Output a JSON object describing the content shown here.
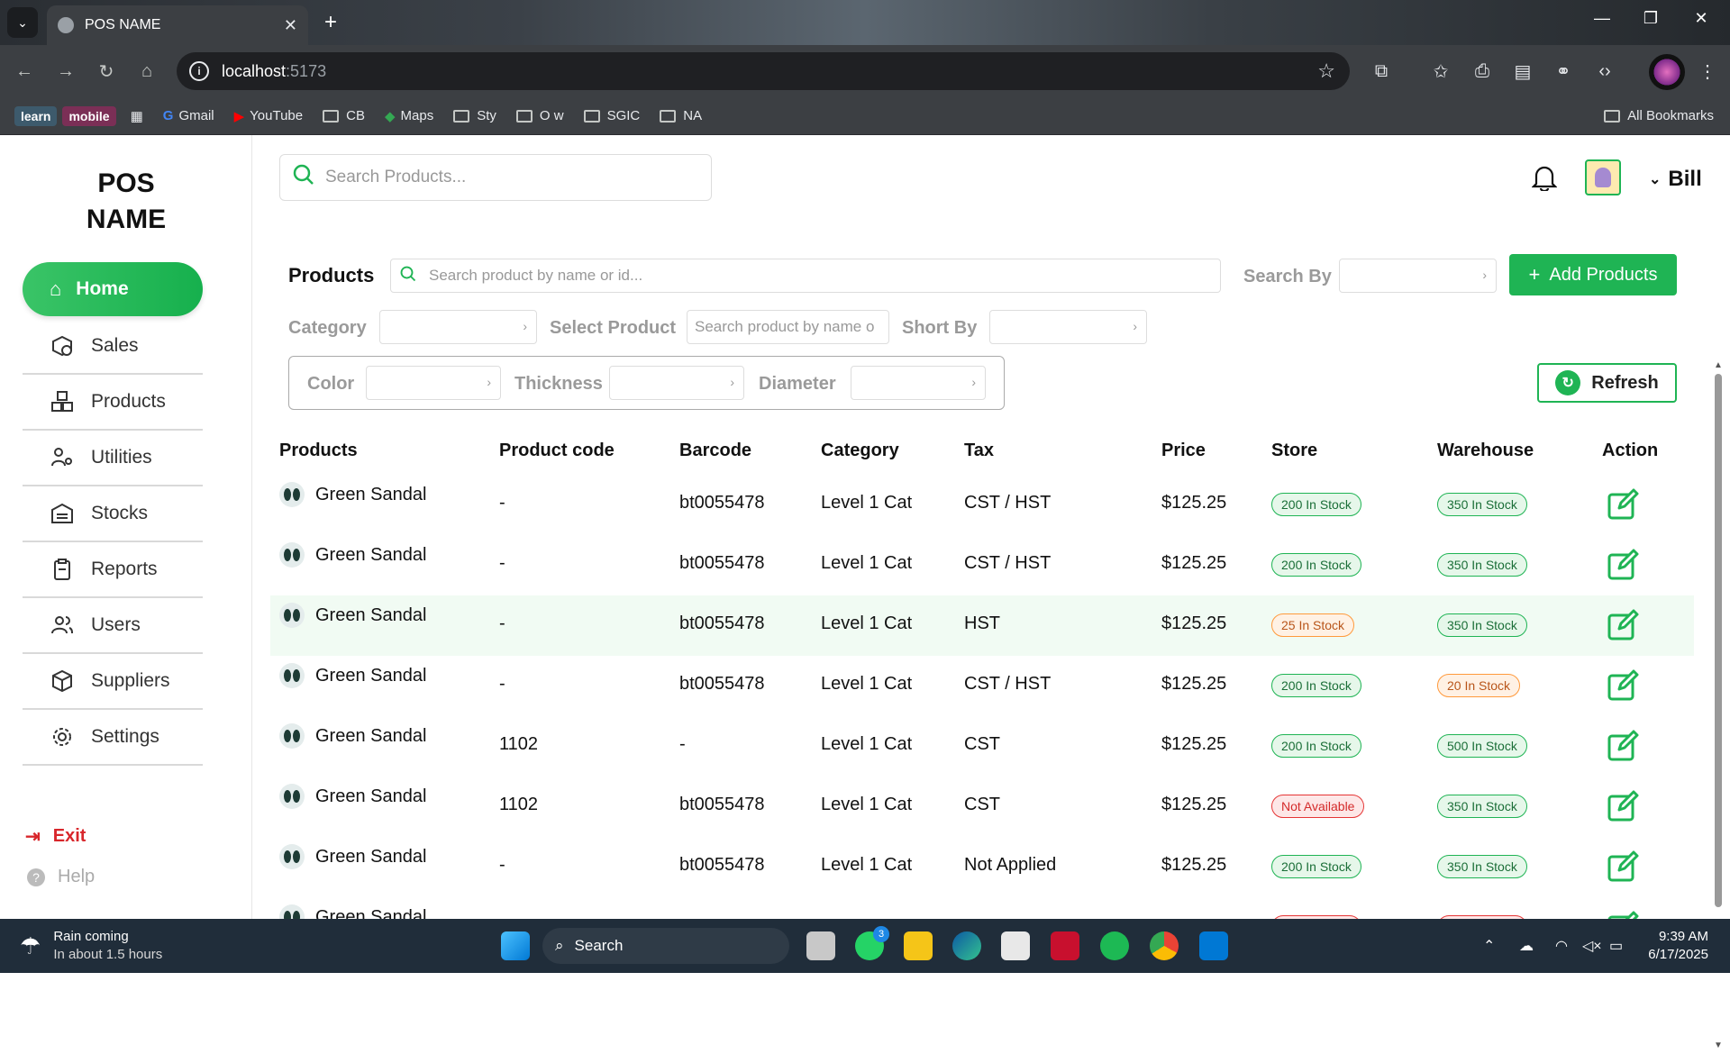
{
  "browser": {
    "tab_title": "POS NAME",
    "url_host": "localhost",
    "url_port": ":5173",
    "bookmarks": [
      "Gmail",
      "YouTube",
      "CB",
      "Maps",
      "Sty",
      "O w",
      "SGIC",
      "NA"
    ],
    "bookmark_pills": [
      "learn",
      "mobile"
    ],
    "all_bookmarks": "All Bookmarks"
  },
  "sidebar": {
    "logo_line1": "POS",
    "logo_line2": "NAME",
    "home": "Home",
    "items": [
      "Sales",
      "Products",
      "Utilities",
      "Stocks",
      "Reports",
      "Users",
      "Suppliers",
      "Settings"
    ],
    "exit": "Exit",
    "help": "Help"
  },
  "header": {
    "search_placeholder": "Search Products...",
    "user_name": "Bill"
  },
  "filters": {
    "title": "Products",
    "product_search_placeholder": "Search product by name or id...",
    "search_by_label": "Search By",
    "add_button": "Add Products",
    "category_label": "Category",
    "select_product_label": "Select Product",
    "select_product_placeholder": "Search product by name o",
    "sort_by_label": "Short By",
    "color_label": "Color",
    "thickness_label": "Thickness",
    "diameter_label": "Diameter",
    "refresh_button": "Refresh"
  },
  "table": {
    "headers": [
      "Products",
      "Product code",
      "Barcode",
      "Category",
      "Tax",
      "Price",
      "Store",
      "Warehouse",
      "Action"
    ],
    "rows": [
      {
        "name": "Green Sandal",
        "code": "-",
        "barcode": "bt0055478",
        "category": "Level 1 Cat",
        "tax": "CST / HST",
        "price": "$125.25",
        "store": "200 In Stock",
        "store_status": "green",
        "warehouse": "350 In Stock",
        "warehouse_status": "green"
      },
      {
        "name": "Green Sandal",
        "code": "-",
        "barcode": "bt0055478",
        "category": "Level 1 Cat",
        "tax": "CST / HST",
        "price": "$125.25",
        "store": "200 In Stock",
        "store_status": "green",
        "warehouse": "350 In Stock",
        "warehouse_status": "green"
      },
      {
        "name": "Green Sandal",
        "code": "-",
        "barcode": "bt0055478",
        "category": "Level 1 Cat",
        "tax": "HST",
        "price": "$125.25",
        "store": "25 In Stock",
        "store_status": "orange",
        "warehouse": "350 In Stock",
        "warehouse_status": "green"
      },
      {
        "name": "Green Sandal",
        "code": "-",
        "barcode": "bt0055478",
        "category": "Level 1 Cat",
        "tax": "CST / HST",
        "price": "$125.25",
        "store": "200 In Stock",
        "store_status": "green",
        "warehouse": "20 In Stock",
        "warehouse_status": "orange"
      },
      {
        "name": "Green Sandal",
        "code": "1102",
        "barcode": "-",
        "category": "Level 1 Cat",
        "tax": "CST",
        "price": "$125.25",
        "store": "200 In Stock",
        "store_status": "green",
        "warehouse": "500 In Stock",
        "warehouse_status": "green"
      },
      {
        "name": "Green Sandal",
        "code": "1102",
        "barcode": "bt0055478",
        "category": "Level 1 Cat",
        "tax": "CST",
        "price": "$125.25",
        "store": "Not Available",
        "store_status": "red",
        "warehouse": "350 In Stock",
        "warehouse_status": "green"
      },
      {
        "name": "Green Sandal",
        "code": "-",
        "barcode": "bt0055478",
        "category": "Level 1 Cat",
        "tax": "Not Applied",
        "price": "$125.25",
        "store": "200 In Stock",
        "store_status": "green",
        "warehouse": "350 In Stock",
        "warehouse_status": "green"
      },
      {
        "name": "Green Sandal",
        "code": "",
        "barcode": "",
        "category": "",
        "tax": "",
        "price": "",
        "store": "",
        "store_status": "red",
        "warehouse": "",
        "warehouse_status": "red"
      }
    ]
  },
  "taskbar": {
    "weather_title": "Rain coming",
    "weather_sub": "In about 1.5 hours",
    "search": "Search",
    "whatsapp_badge": "3",
    "time": "9:39 AM",
    "date": "6/17/2025"
  },
  "colors": {
    "accent": "#1fb454",
    "danger": "#d8262b",
    "warning": "#ff9a3c"
  }
}
